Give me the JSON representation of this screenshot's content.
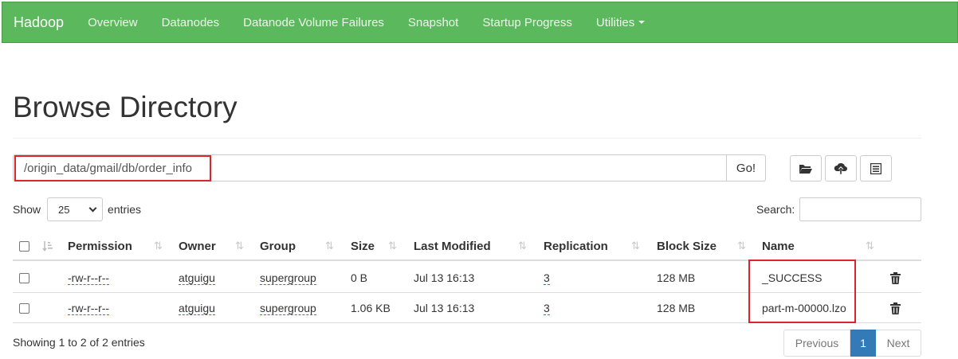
{
  "navbar": {
    "brand": "Hadoop",
    "items": [
      "Overview",
      "Datanodes",
      "Datanode Volume Failures",
      "Snapshot",
      "Startup Progress",
      "Utilities"
    ],
    "color": "#5cb85c"
  },
  "page": {
    "title": "Browse Directory"
  },
  "path_bar": {
    "value": "/origin_data/gmail/db/order_info",
    "go_label": "Go!"
  },
  "toolbar": {
    "icons": [
      "folder-open-icon",
      "cloud-upload-icon",
      "list-icon"
    ]
  },
  "show": {
    "label_before": "Show",
    "selected": "25",
    "label_after": "entries"
  },
  "search": {
    "label": "Search:",
    "value": ""
  },
  "table": {
    "columns": [
      "Permission",
      "Owner",
      "Group",
      "Size",
      "Last Modified",
      "Replication",
      "Block Size",
      "Name"
    ],
    "rows": [
      {
        "permission": "-rw-r--r--",
        "owner": "atguigu",
        "group": "supergroup",
        "size": "0 B",
        "modified": "Jul 13 16:13",
        "replication": "3",
        "block_size": "128 MB",
        "name": "_SUCCESS"
      },
      {
        "permission": "-rw-r--r--",
        "owner": "atguigu",
        "group": "supergroup",
        "size": "1.06 KB",
        "modified": "Jul 13 16:13",
        "replication": "3",
        "block_size": "128 MB",
        "name": "part-m-00000.lzo"
      }
    ]
  },
  "footer": {
    "info": "Showing 1 to 2 of 2 entries",
    "previous": "Previous",
    "current": "1",
    "next": "Next"
  },
  "colors": {
    "link": "#337ab7",
    "highlight_box": "#d9252b"
  }
}
